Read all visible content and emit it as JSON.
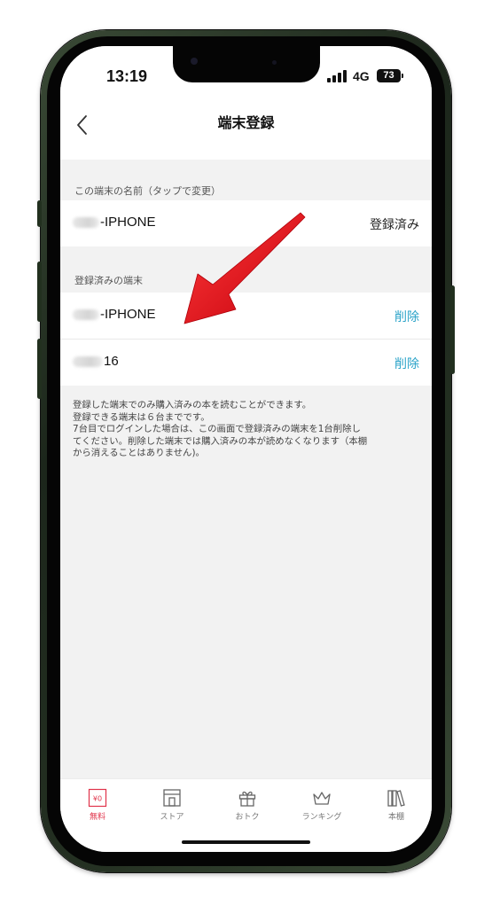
{
  "status_bar": {
    "time": "13:19",
    "network": "4G",
    "battery": "73"
  },
  "nav": {
    "title": "端末登録",
    "back_icon": "chevron-left-icon"
  },
  "this_device": {
    "section_label": "この端末の名前（タップで変更）",
    "device_name": "-IPHONE",
    "status": "登録済み"
  },
  "registered": {
    "section_label": "登録済みの端末",
    "devices": [
      {
        "name": "-IPHONE",
        "action": "削除"
      },
      {
        "name": "16",
        "action": "削除"
      }
    ]
  },
  "notes": [
    "登録した端末でのみ購入済みの本を読むことができます。",
    "登録できる端末は６台までです。",
    "7台目でログインした場合は、この画面で登録済みの端末を1台削除し",
    "てください。削除した端末では購入済みの本が読めなくなります（本棚",
    "から消えることはありません)。"
  ],
  "tabs": [
    {
      "label": "無料",
      "icon": "yen-coupon-icon",
      "active": true
    },
    {
      "label": "ストア",
      "icon": "store-icon",
      "active": false
    },
    {
      "label": "おトク",
      "icon": "gift-icon",
      "active": false
    },
    {
      "label": "ランキング",
      "icon": "crown-icon",
      "active": false
    },
    {
      "label": "本棚",
      "icon": "bookshelf-icon",
      "active": false
    }
  ],
  "tab_icon_text": {
    "free": "¥0"
  },
  "colors": {
    "accent": "#2aa3c8",
    "active_tab": "#e0334a",
    "arrow": "#d8101e"
  }
}
